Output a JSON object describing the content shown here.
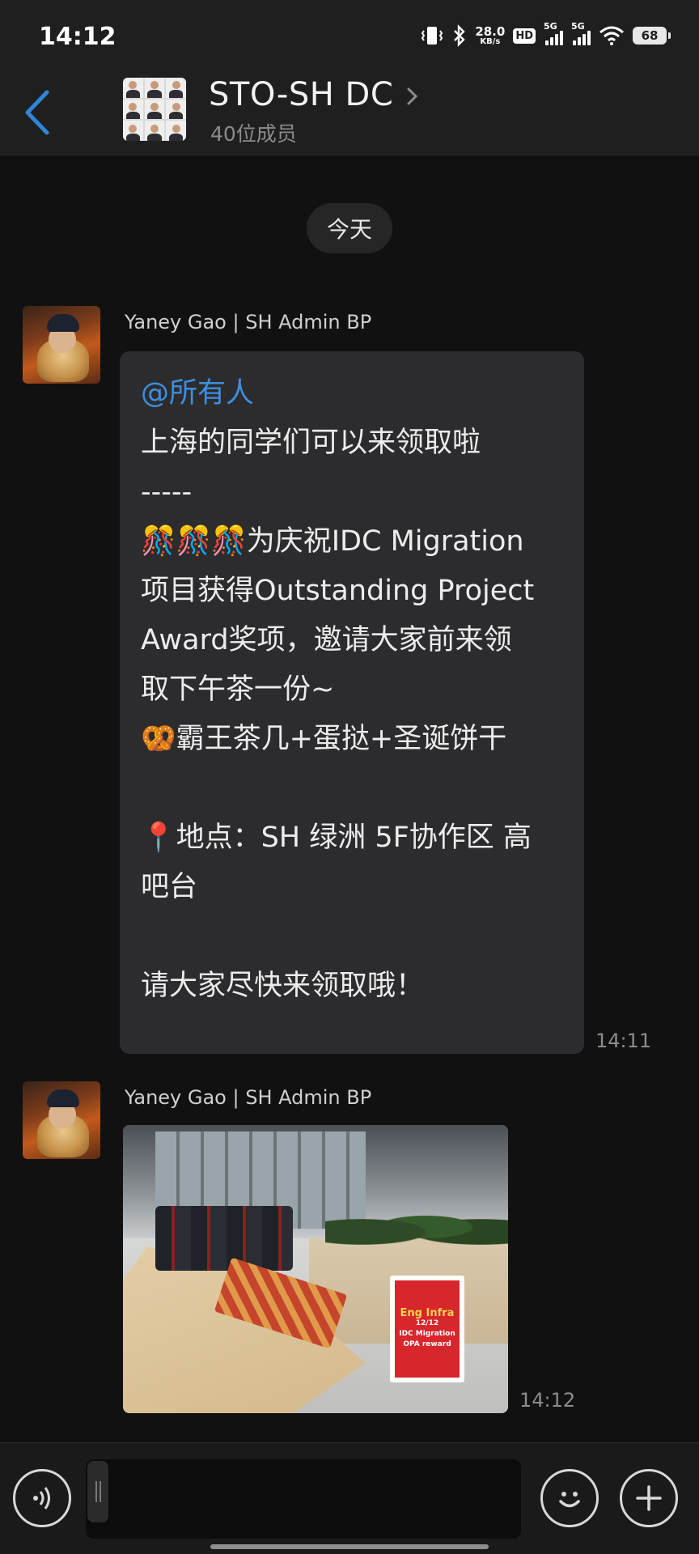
{
  "status_bar": {
    "time": "14:12",
    "net_speed_value": "28.0",
    "net_speed_unit": "KB/s",
    "hd_label": "HD",
    "sim1_label": "5G",
    "sim2_label": "5G",
    "battery": "68"
  },
  "header": {
    "title": "STO-SH DC",
    "member_count": "40位成员"
  },
  "chat": {
    "date_label": "今天",
    "messages": [
      {
        "sender": "Yaney Gao | SH Admin BP",
        "mention": "@所有人",
        "lines": [
          "上海的同学们可以来领取啦",
          "-----",
          "🎊🎊🎊为庆祝IDC Migration",
          "项目获得Outstanding Project",
          "Award奖项，邀请大家前来领",
          "取下午茶一份~",
          "🥨霸王茶几+蛋挞+圣诞饼干",
          "",
          "📍地点：SH 绿洲 5F协作区 高",
          "吧台",
          "",
          "请大家尽快来领取哦！"
        ],
        "time": "14:11"
      },
      {
        "sender": "Yaney Gao | SH Admin BP",
        "image_sign": {
          "title": "Eng Infra",
          "date": "12/12",
          "line1": "IDC Migration",
          "line2": "OPA reward"
        },
        "time": "14:12"
      }
    ]
  },
  "input_bar": {
    "placeholder": ""
  },
  "icons": {
    "back": "chevron-left-icon",
    "voice": "voice-icon",
    "emoji": "emoji-icon",
    "plus": "plus-icon"
  },
  "colors": {
    "accent": "#3d8fe0",
    "bubble": "#2c2c2e",
    "background": "#111111"
  }
}
